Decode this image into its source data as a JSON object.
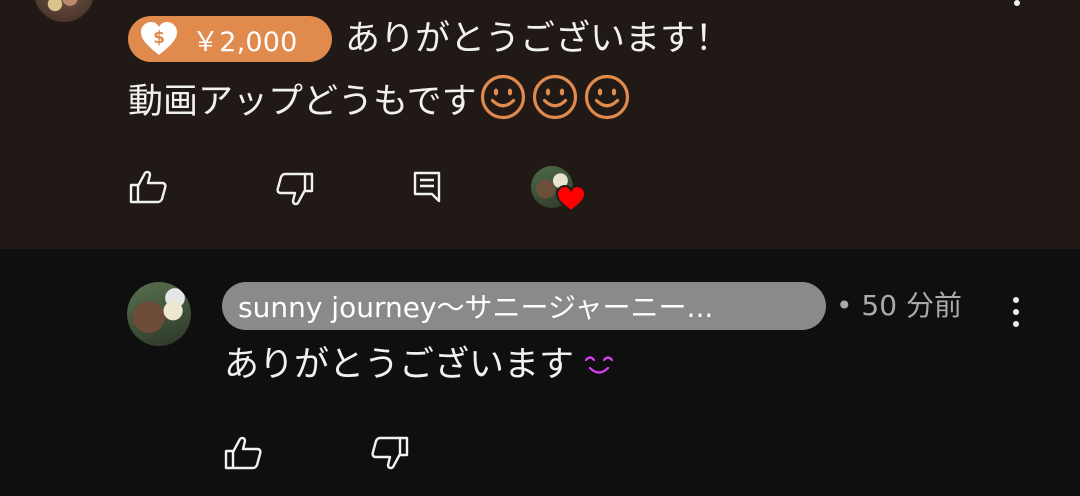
{
  "super_chat": {
    "amount": "￥2,000",
    "message_line1": "ありがとうございます！",
    "message_line2": "動画アップどうもです",
    "smiley_count": 3,
    "chip_color": "#e08a4e",
    "smiley_color": "#e08a4e"
  },
  "super_actions": {
    "like_icon": "thumbs-up-icon",
    "dislike_icon": "thumbs-down-icon",
    "reply_icon": "reply-comment-icon",
    "creator_heart_icon": "heart-icon",
    "heart_color": "#ff0000"
  },
  "reply": {
    "author": "sunny journey〜サニージャーニー...",
    "time": "• 50 分前",
    "text": "ありがとうございます",
    "blush_color": "#e040fb",
    "more_icon": "more-vert-icon"
  },
  "reply_actions": {
    "like_icon": "thumbs-up-icon",
    "dislike_icon": "thumbs-down-icon"
  },
  "colors": {
    "super_background": "#211916",
    "page_background": "#0f0f0f",
    "author_chip": "#8a8a8a"
  }
}
